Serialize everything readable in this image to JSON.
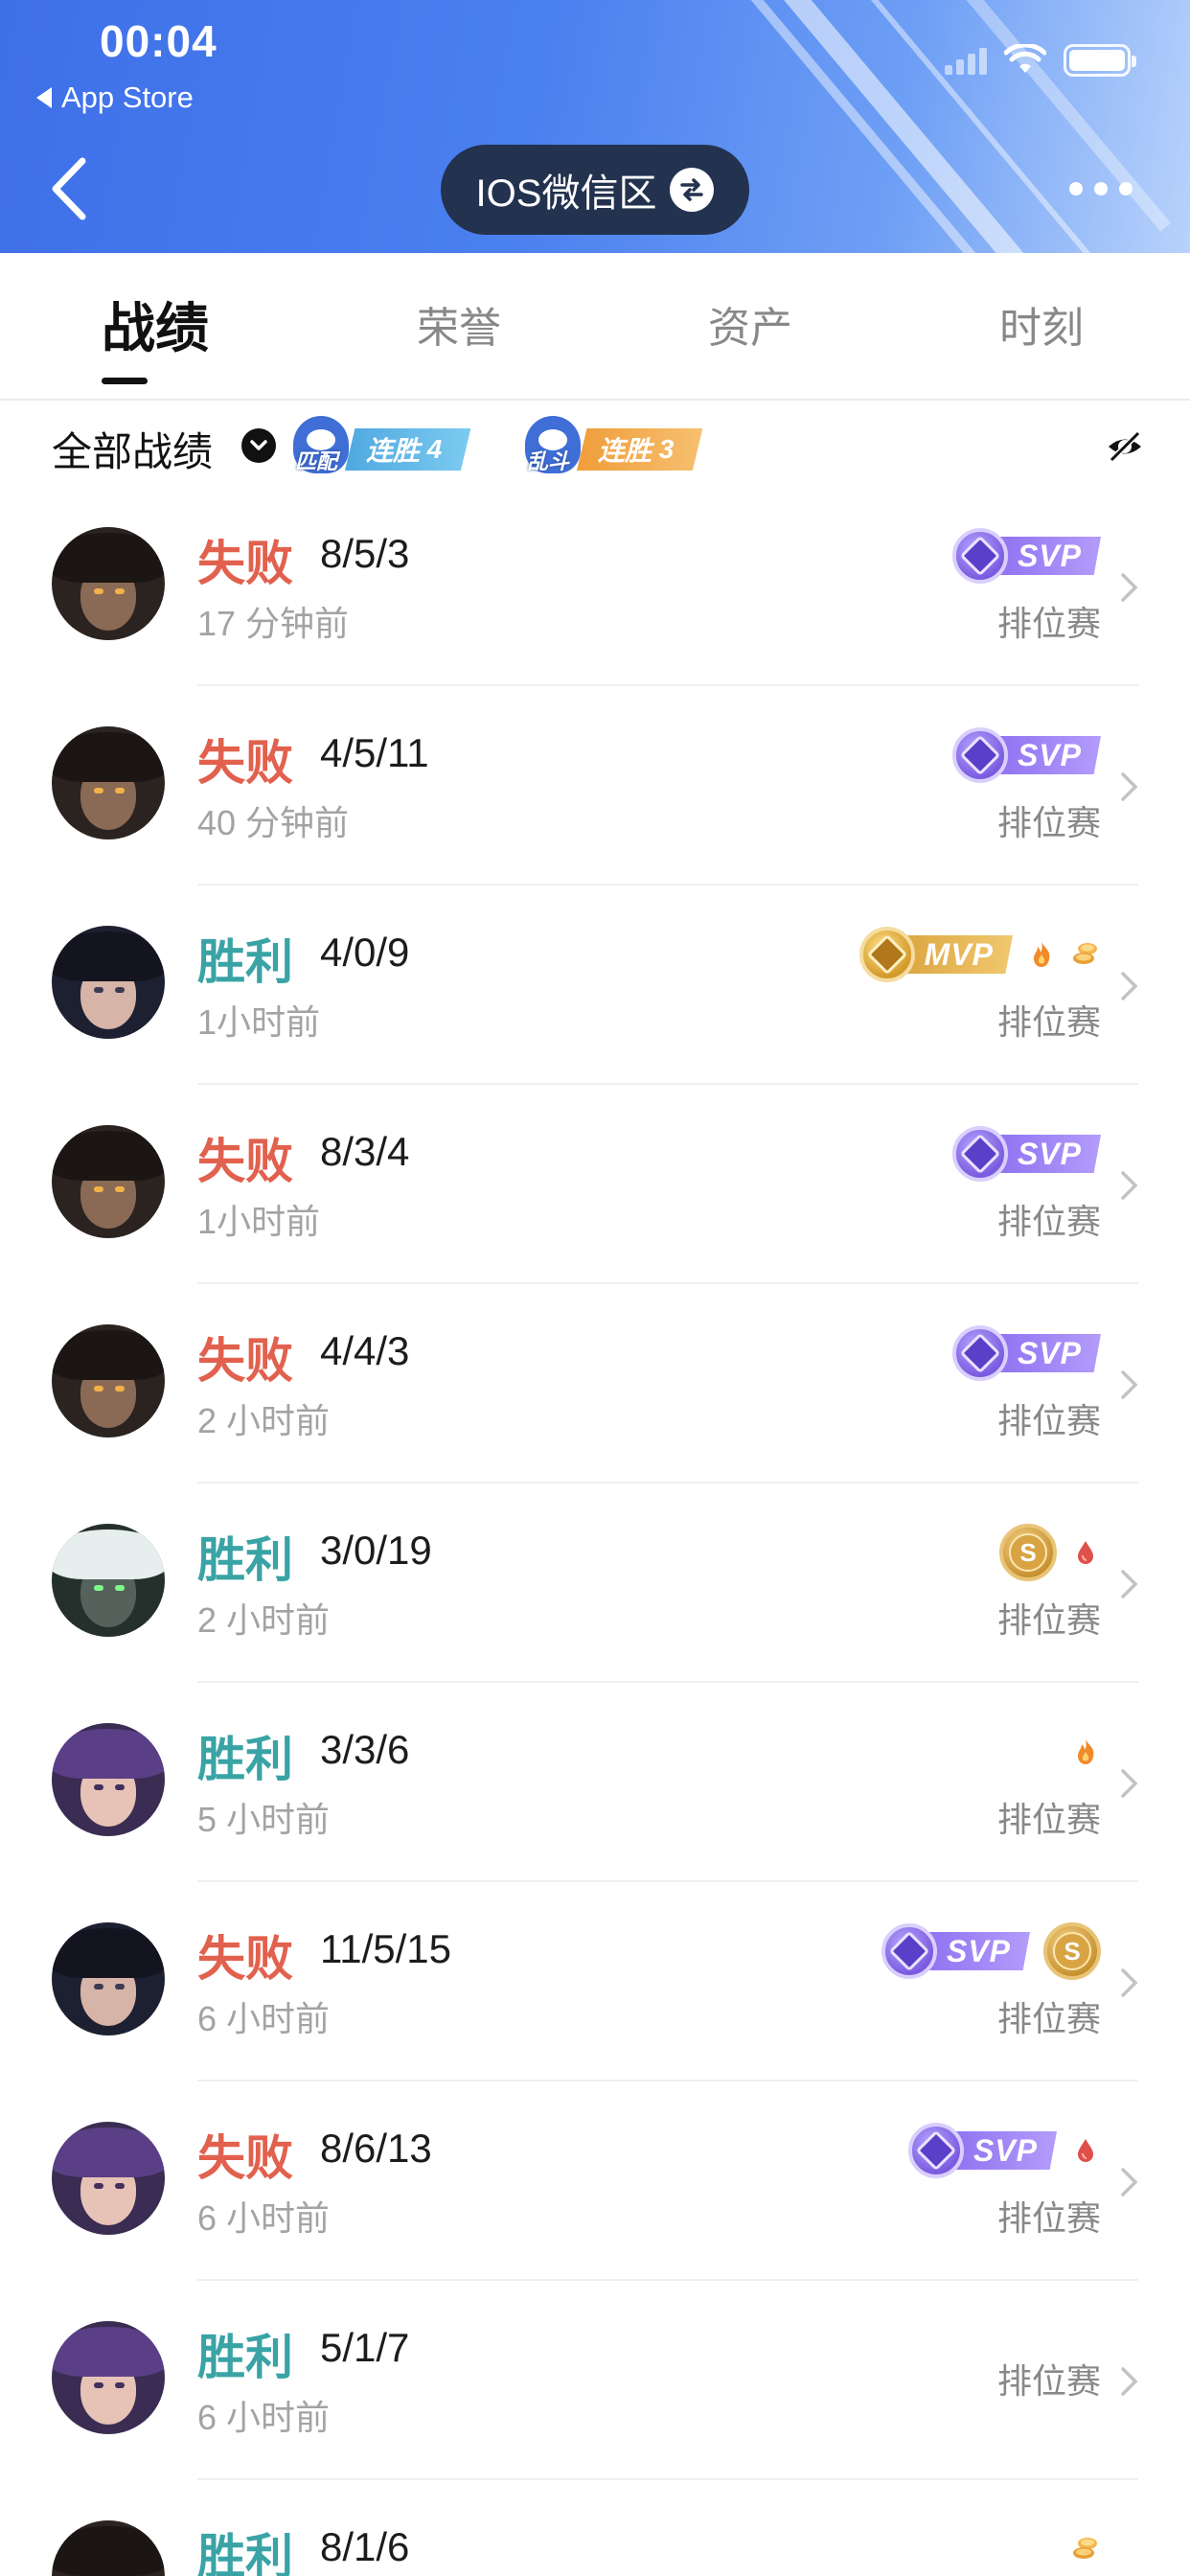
{
  "status_bar": {
    "time": "00:04",
    "back_app": "App Store"
  },
  "header": {
    "server_label": "IOS微信区"
  },
  "tabs": [
    {
      "label": "战绩",
      "active": true
    },
    {
      "label": "荣誉",
      "active": false
    },
    {
      "label": "资产",
      "active": false
    },
    {
      "label": "时刻",
      "active": false
    }
  ],
  "filter": {
    "label": "全部战绩",
    "streaks": [
      {
        "mode": "匹配",
        "text": "连胜",
        "count": "4",
        "color": "#5ab7e6"
      },
      {
        "mode": "乱斗",
        "text": "连胜",
        "count": "3",
        "color": "#f0a545"
      }
    ]
  },
  "colors": {
    "win": "#3aa3a5",
    "loss": "#e1614e",
    "svp": "#9b80f5",
    "mvp": "#dca84a"
  },
  "badge_labels": {
    "svp": "SVP",
    "mvp": "MVP",
    "coin": "S"
  },
  "matches": [
    {
      "result": "失败",
      "kda": "8/5/3",
      "ago": "17 分钟前",
      "mode": "排位赛",
      "hero": "cowboy"
    },
    {
      "result": "失败",
      "kda": "4/5/11",
      "ago": "40 分钟前",
      "mode": "排位赛",
      "hero": "cowboy"
    },
    {
      "result": "胜利",
      "kda": "4/0/9",
      "ago": "1小时前",
      "mode": "排位赛",
      "hero": "sniper"
    },
    {
      "result": "失败",
      "kda": "8/3/4",
      "ago": "1小时前",
      "mode": "排位赛",
      "hero": "cowboy"
    },
    {
      "result": "失败",
      "kda": "4/4/3",
      "ago": "2 小时前",
      "mode": "排位赛",
      "hero": "cowboy"
    },
    {
      "result": "胜利",
      "kda": "3/0/19",
      "ago": "2 小时前",
      "mode": "排位赛",
      "hero": "witch"
    },
    {
      "result": "胜利",
      "kda": "3/3/6",
      "ago": "5 小时前",
      "mode": "排位赛",
      "hero": "mage"
    },
    {
      "result": "失败",
      "kda": "11/5/15",
      "ago": "6 小时前",
      "mode": "排位赛",
      "hero": "sniper"
    },
    {
      "result": "失败",
      "kda": "8/6/13",
      "ago": "6 小时前",
      "mode": "排位赛",
      "hero": "mage"
    },
    {
      "result": "胜利",
      "kda": "5/1/7",
      "ago": "6 小时前",
      "mode": "排位赛",
      "hero": "mage"
    },
    {
      "result": "胜利",
      "kda": "8/1/6",
      "ago": "",
      "mode": "",
      "hero": "cowboy"
    }
  ]
}
